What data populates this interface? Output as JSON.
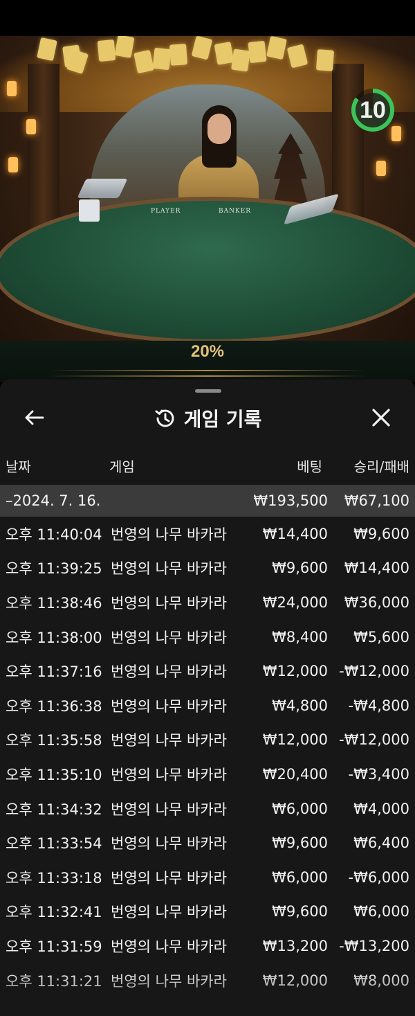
{
  "timer": {
    "value": "10",
    "progress": 0.85
  },
  "scene": {
    "player_label": "PLAYER",
    "banker_label": "BANKER",
    "percent": "20%"
  },
  "colors": {
    "timer_green": "#3cc35a",
    "percent_gold": "#e2c27a",
    "sheet_bg": "#171717",
    "date_row_bg": "#3b3b3b"
  },
  "history": {
    "title": "게임 기록",
    "icons": {
      "back": "arrow-left-icon",
      "history": "history-icon",
      "close": "close-icon"
    },
    "columns": {
      "date": "날짜",
      "game": "게임",
      "bet": "베팅",
      "result": "승리/패배"
    },
    "date_group": {
      "date": "–2024. 7. 16.",
      "bet_total": "₩193,500",
      "result_total": "₩67,100"
    },
    "rows": [
      {
        "time": "오후 11:40:04",
        "game": "번영의 나무 바카라",
        "bet": "₩14,400",
        "result": "₩9,600"
      },
      {
        "time": "오후 11:39:25",
        "game": "번영의 나무 바카라",
        "bet": "₩9,600",
        "result": "₩14,400"
      },
      {
        "time": "오후 11:38:46",
        "game": "번영의 나무 바카라",
        "bet": "₩24,000",
        "result": "₩36,000"
      },
      {
        "time": "오후 11:38:00",
        "game": "번영의 나무 바카라",
        "bet": "₩8,400",
        "result": "₩5,600"
      },
      {
        "time": "오후 11:37:16",
        "game": "번영의 나무 바카라",
        "bet": "₩12,000",
        "result": "-₩12,000"
      },
      {
        "time": "오후 11:36:38",
        "game": "번영의 나무 바카라",
        "bet": "₩4,800",
        "result": "-₩4,800"
      },
      {
        "time": "오후 11:35:58",
        "game": "번영의 나무 바카라",
        "bet": "₩12,000",
        "result": "-₩12,000"
      },
      {
        "time": "오후 11:35:10",
        "game": "번영의 나무 바카라",
        "bet": "₩20,400",
        "result": "-₩3,400"
      },
      {
        "time": "오후 11:34:32",
        "game": "번영의 나무 바카라",
        "bet": "₩6,000",
        "result": "₩4,000"
      },
      {
        "time": "오후 11:33:54",
        "game": "번영의 나무 바카라",
        "bet": "₩9,600",
        "result": "₩6,400"
      },
      {
        "time": "오후 11:33:18",
        "game": "번영의 나무 바카라",
        "bet": "₩6,000",
        "result": "-₩6,000"
      },
      {
        "time": "오후 11:32:41",
        "game": "번영의 나무 바카라",
        "bet": "₩9,600",
        "result": "₩6,000"
      },
      {
        "time": "오후 11:31:59",
        "game": "번영의 나무 바카라",
        "bet": "₩13,200",
        "result": "-₩13,200"
      },
      {
        "time": "오후 11:31:21",
        "game": "번영의 나무 바카라",
        "bet": "₩12,000",
        "result": "₩8,000"
      }
    ]
  }
}
